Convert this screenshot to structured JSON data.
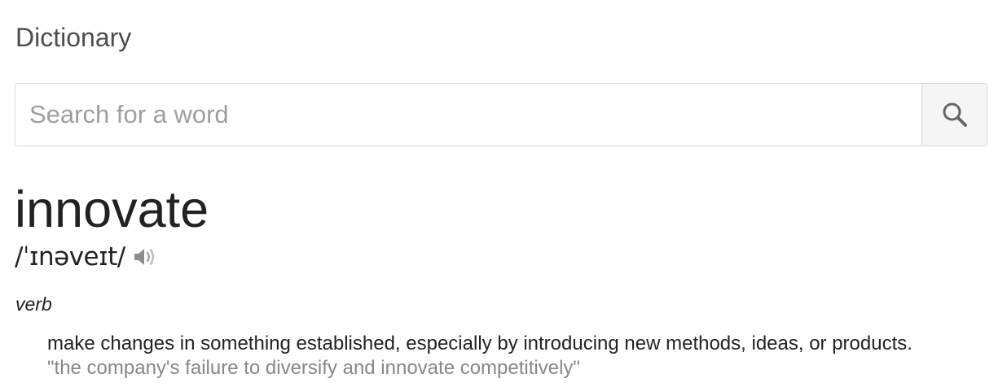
{
  "header": {
    "title": "Dictionary"
  },
  "search": {
    "placeholder": "Search for a word",
    "value": "",
    "button_icon": "search-icon"
  },
  "entry": {
    "word": "innovate",
    "pronunciation": "/ˈɪnəveɪt/",
    "audio_icon": "speaker-icon",
    "part_of_speech": "verb",
    "senses": [
      {
        "definition": "make changes in something established, especially by introducing new methods, ideas, or products.",
        "example": "\"the company's failure to diversify and innovate competitively\""
      }
    ]
  },
  "colors": {
    "text": "#222222",
    "title": "#4d4d4d",
    "example": "#878787",
    "placeholder": "#9e9e9e",
    "border": "#d9d9d9",
    "button_bg": "#f5f5f5",
    "icon": "#666666"
  }
}
